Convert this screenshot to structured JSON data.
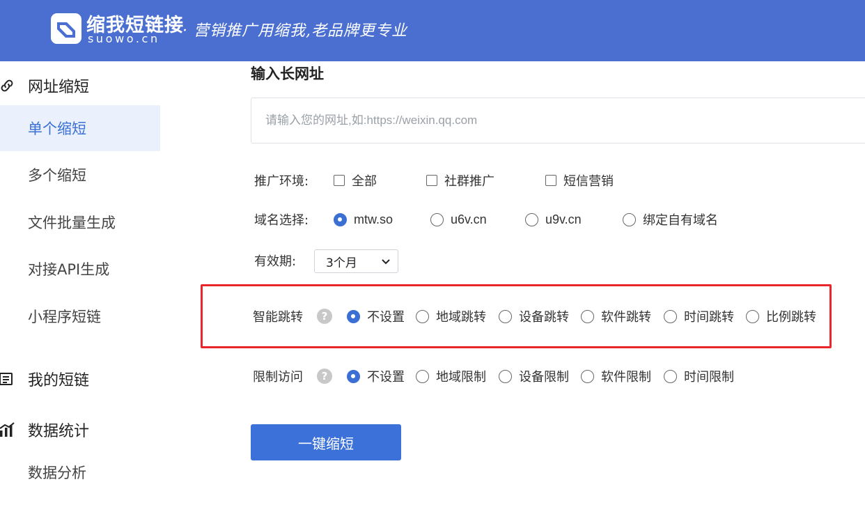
{
  "header": {
    "brand_cn": "缩我短链接",
    "brand_en": "suowo.cn",
    "slogan": "· 营销推广用缩我,老品牌更专业",
    "bg_color": "#4a6fd1"
  },
  "sidebar": {
    "group1": {
      "label": "网址缩短",
      "icon": "link-icon"
    },
    "items": [
      {
        "label": "单个缩短",
        "active": true
      },
      {
        "label": "多个缩短"
      },
      {
        "label": "文件批量生成"
      },
      {
        "label": "对接API生成"
      },
      {
        "label": "小程序短链"
      }
    ],
    "group2": {
      "label": "我的短链",
      "icon": "list-icon"
    },
    "group3": {
      "label": "数据统计",
      "icon": "bar-chart-icon"
    },
    "items3": [
      {
        "label": "数据分析"
      }
    ]
  },
  "main": {
    "title": "输入长网址",
    "url_input": {
      "placeholder": "请输入您的网址,如:https://weixin.qq.com",
      "value": ""
    },
    "env": {
      "label": "推广环境:",
      "options": [
        "全部",
        "社群推广",
        "短信营销"
      ]
    },
    "domain": {
      "label": "域名选择:",
      "options": [
        "mtw.so",
        "u6v.cn",
        "u9v.cn",
        "绑定自有域名"
      ],
      "selected": "mtw.so"
    },
    "validity": {
      "label": "有效期:",
      "value": "3个月"
    },
    "smart_jump": {
      "label": "智能跳转",
      "options": [
        "不设置",
        "地域跳转",
        "设备跳转",
        "软件跳转",
        "时间跳转",
        "比例跳转"
      ],
      "selected": "不设置"
    },
    "restrict": {
      "label": "限制访问",
      "options": [
        "不设置",
        "地域限制",
        "设备限制",
        "软件限制",
        "时间限制"
      ],
      "selected": "不设置"
    },
    "submit_label": "一键缩短",
    "accent_color": "#3b71d8",
    "highlight_color": "#e8262b"
  }
}
